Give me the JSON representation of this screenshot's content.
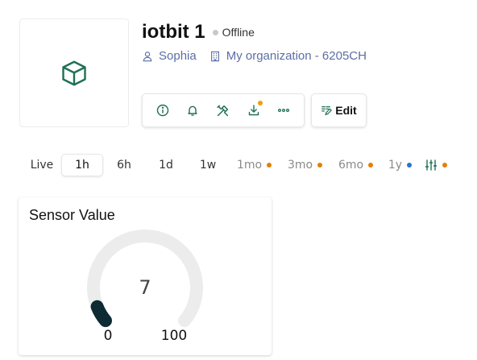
{
  "device": {
    "name": "iotbit 1",
    "status": "Offline",
    "owner": "Sophia",
    "organization": "My organization - 6205CH"
  },
  "toolbar": {
    "edit_label": "Edit",
    "buttons": [
      {
        "icon": "info-icon"
      },
      {
        "icon": "bell-icon"
      },
      {
        "icon": "tools-icon"
      },
      {
        "icon": "download-icon",
        "badge": true
      },
      {
        "icon": "more-icon"
      }
    ]
  },
  "time_ranges": [
    {
      "label": "Live"
    },
    {
      "label": "1h",
      "active": true
    },
    {
      "label": "6h"
    },
    {
      "label": "1d"
    },
    {
      "label": "1w"
    },
    {
      "label": "1mo",
      "dot": "#e67e00"
    },
    {
      "label": "3mo",
      "dot": "#e67e00"
    },
    {
      "label": "6mo",
      "dot": "#e67e00"
    },
    {
      "label": "1y",
      "dot": "#2a6fd6"
    },
    {
      "icon": "sliders-icon",
      "dot": "#e67e00"
    }
  ],
  "widget": {
    "title": "Sensor Value",
    "value": "7",
    "min_label": "0",
    "max_label": "100",
    "gauge_fraction": 0.07
  },
  "colors": {
    "accent": "#1f6f55",
    "link": "#5b6fa6",
    "gauge_track": "#ececec",
    "gauge_fill": "#0e2a33",
    "dot_orange": "#e67e00",
    "dot_blue": "#2a6fd6"
  }
}
